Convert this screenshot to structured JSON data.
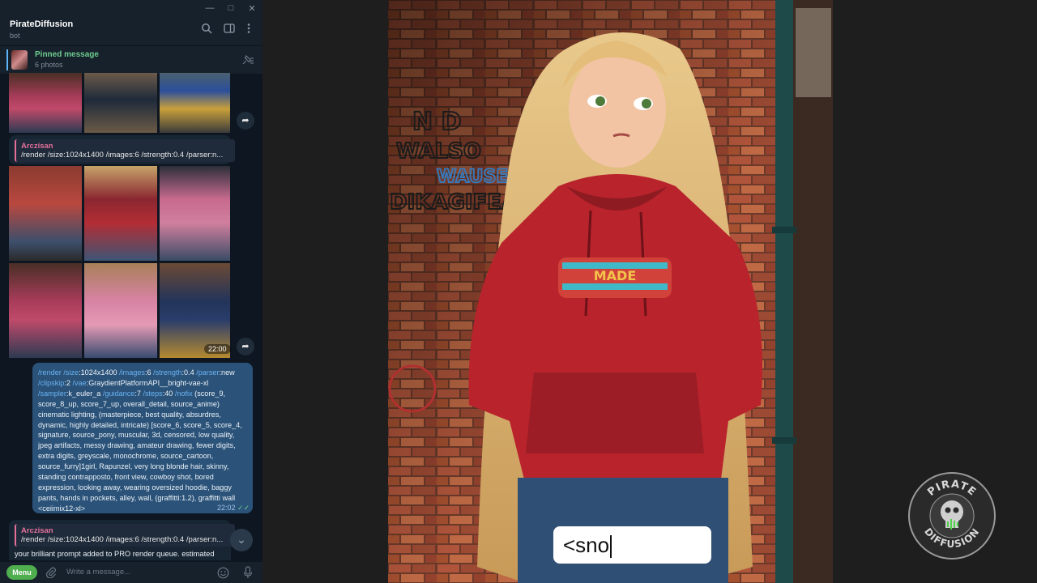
{
  "window": {
    "controls": [
      "—",
      "□",
      "✕"
    ]
  },
  "chat": {
    "name": "PirateDiffusion",
    "subtitle": "bot"
  },
  "pinned": {
    "title": "Pinned message",
    "count": "6 photos"
  },
  "messages": {
    "reply1": {
      "author": "Arczisan",
      "quote": "/render /size:1024x1400 /images:6 /strength:0.4 /parser:n...",
      "time": "22:00"
    },
    "outgoing": {
      "line1_cmd1": "/render",
      "line1_t1": " ",
      "line1_cmd2": "/size",
      "line1_t2": ":1024x1400 ",
      "line1_cmd3": "/images",
      "line1_t3": ":6 ",
      "line1_cmd4": "/strength",
      "line1_t4": ":0.4 ",
      "line1_cmd5": "/parser",
      "line1_t5": ":new",
      "line2_cmd1": "/clipskip",
      "line2_t1": ":2 ",
      "line2_cmd2": "/vae",
      "line2_t2": ":GraydientPlatformAPI__bright-vae-xl",
      "line3_cmd1": "/sampler",
      "line3_t1": ":k_euler_a ",
      "line3_cmd2": "/guidance",
      "line3_t2": ":7 ",
      "line3_cmd3": "/steps",
      "line3_t3": ":40 ",
      "line3_cmd4": "/nofix",
      "line3_t4": " (score_9,",
      "body": "score_8_up, score_7_up, overall_detail, source_anime)\ncinematic lighting, (masterpiece, best quality, absurdres,\ndynamic, highly detailed, intricate) [score_6, score_5, score_4,\nsignature, source_pony, muscular, 3d, censored, low quality,\njpeg artifacts, messy drawing, amateur drawing, fewer digits,\nextra digits, greyscale, monochrome, source_cartoon,\nsource_furry]1girl, Rapunzel, very long blonde hair, skinny,\nstanding contrapposto, front view, cowboy shot, bored\nexpression, looking away, wearing oversized hoodie, baggy\npants, hands in pockets, alley, wall, (graffitti:1.2), graffitti wall\n<ceiimix12-xl>",
      "time": "22:02",
      "ticks": "✓✓"
    },
    "reply2": {
      "author": "Arczisan",
      "quote": "/render /size:1024x1400 /images:6 /strength:0.4 /parser:n...",
      "text": "your brilliant prompt added to PRO render queue. estimated"
    }
  },
  "composer": {
    "menu_label": "Menu",
    "placeholder": "Write a message..."
  },
  "artwork": {
    "graffiti": [
      "N D",
      "WALSO",
      "WAUSE",
      "DIKAGIFEAT",
      "MADE"
    ],
    "caption": "<sno"
  },
  "logo": {
    "top_text": "PIRATE",
    "bottom_text": "DIFFUSION"
  },
  "colors": {
    "telegram_bg": "#0e1621",
    "outgoing_bubble": "#2b5278",
    "command_blue": "#6ab3f3",
    "author_pink": "#e36f9a",
    "menu_green": "#4fae4e",
    "hoodie_red": "#b8232c"
  }
}
